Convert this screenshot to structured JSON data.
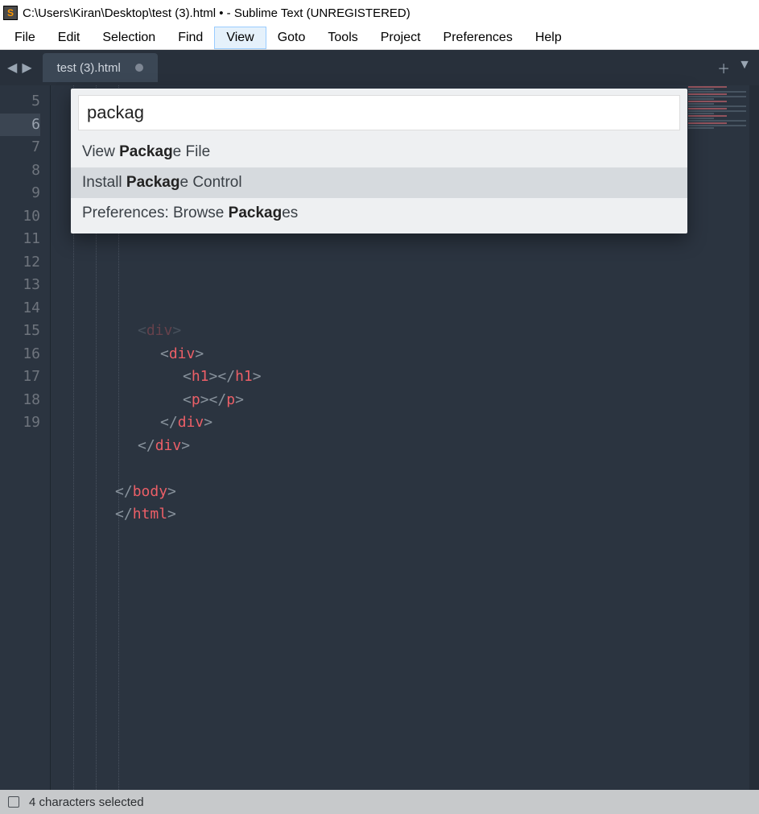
{
  "window": {
    "title": "C:\\Users\\Kiran\\Desktop\\test (3).html • - Sublime Text (UNREGISTERED)",
    "logo_letter": "S"
  },
  "menubar": {
    "items": [
      "File",
      "Edit",
      "Selection",
      "Find",
      "View",
      "Goto",
      "Tools",
      "Project",
      "Preferences",
      "Help"
    ],
    "active_index": 4
  },
  "tabs": {
    "items": [
      {
        "label": "test (3).html",
        "dirty": true
      }
    ]
  },
  "gutter": {
    "start": 5,
    "end": 19,
    "active": 6
  },
  "code_lines": {
    "l10": {
      "indent": 3,
      "open": "",
      "tag": "div",
      "close_same": false,
      "trail": ">",
      "is_close": true,
      "raw": "<div>"
    },
    "l11": {
      "indent": 4,
      "tag": "div"
    },
    "l12": {
      "indent": 5,
      "tag": "h1"
    },
    "l13": {
      "indent": 5,
      "tag": "p"
    },
    "l14": {
      "indent": 4,
      "tag": "div"
    },
    "l15": {
      "indent": 3,
      "tag": "div"
    },
    "l17": {
      "indent": 2,
      "tag": "body"
    },
    "l18": {
      "indent": 2,
      "tag": "html"
    }
  },
  "palette": {
    "input_value": "packag",
    "items": [
      {
        "pre": "View ",
        "match": "Packag",
        "post": "e File",
        "selected": false
      },
      {
        "pre": "Install ",
        "match": "Packag",
        "post": "e Control",
        "selected": true
      },
      {
        "pre": "Preferences: Browse ",
        "match": "Packag",
        "post": "es",
        "selected": false
      }
    ]
  },
  "statusbar": {
    "message": "4 characters selected"
  },
  "colors": {
    "editor_bg": "#2b3440",
    "tag": "#ec5f67",
    "punct": "#88929c"
  }
}
